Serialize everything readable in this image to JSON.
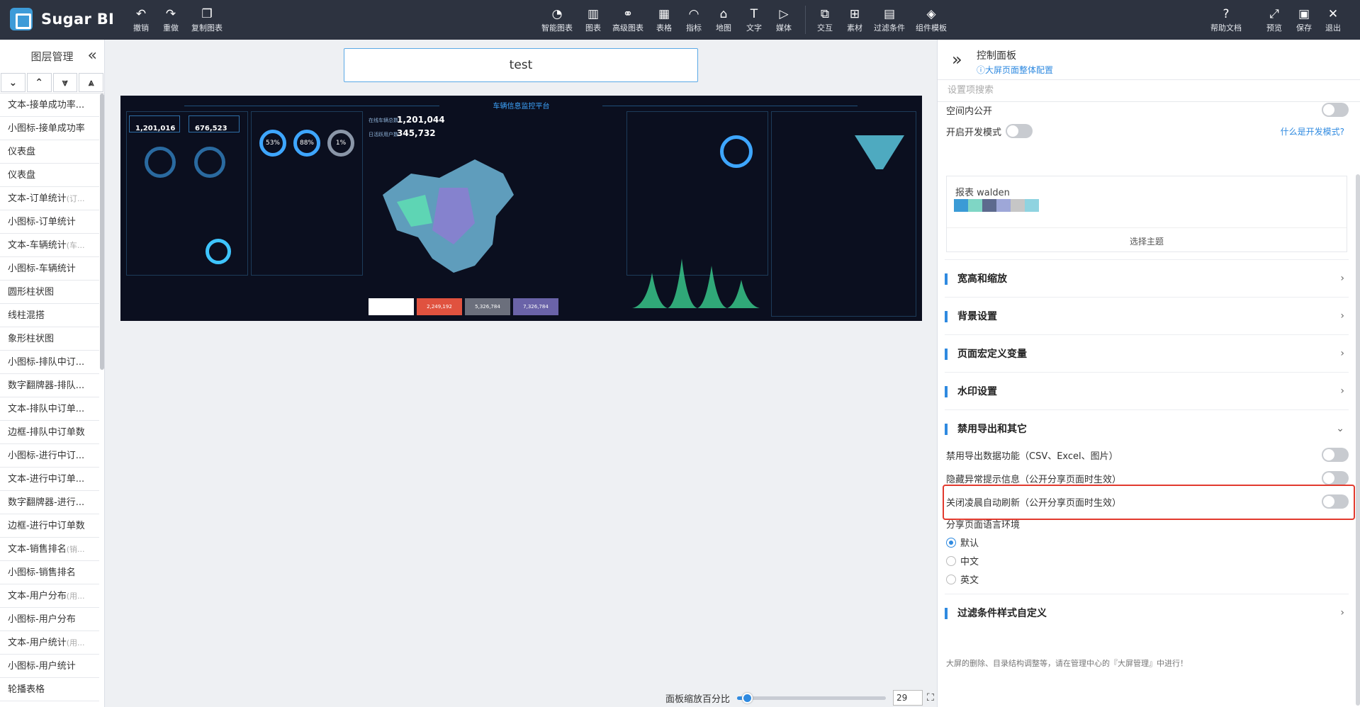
{
  "app": {
    "name": "Sugar BI"
  },
  "toolbar": {
    "undo": "撤销",
    "redo": "重做",
    "copy": "复制图表",
    "smart_chart": "智能图表",
    "chart": "图表",
    "advanced_chart": "高级图表",
    "table": "表格",
    "metric": "指标",
    "map": "地图",
    "text": "文字",
    "media": "媒体",
    "interaction": "交互",
    "material": "素材",
    "filter": "过滤条件",
    "component_template": "组件模板",
    "help": "帮助文档",
    "preview": "预览",
    "save": "保存",
    "exit": "退出"
  },
  "layers": {
    "title": "图层管理",
    "items": [
      {
        "label": "文本-接单成功率...",
        "hint": ""
      },
      {
        "label": "小图标-接单成功率",
        "hint": ""
      },
      {
        "label": "仪表盘",
        "hint": ""
      },
      {
        "label": "仪表盘",
        "hint": ""
      },
      {
        "label": "文本-订单统计",
        "hint": "(订..."
      },
      {
        "label": "小图标-订单统计",
        "hint": ""
      },
      {
        "label": "文本-车辆统计",
        "hint": "(车..."
      },
      {
        "label": "小图标-车辆统计",
        "hint": ""
      },
      {
        "label": "圆形柱状图",
        "hint": ""
      },
      {
        "label": "线柱混搭",
        "hint": ""
      },
      {
        "label": "象形柱状图",
        "hint": ""
      },
      {
        "label": "小图标-排队中订...",
        "hint": ""
      },
      {
        "label": "数字翻牌器-排队...",
        "hint": ""
      },
      {
        "label": "文本-排队中订单...",
        "hint": ""
      },
      {
        "label": "边框-排队中订单数",
        "hint": ""
      },
      {
        "label": "小图标-进行中订...",
        "hint": ""
      },
      {
        "label": "文本-进行中订单...",
        "hint": ""
      },
      {
        "label": "数字翻牌器-进行...",
        "hint": ""
      },
      {
        "label": "边框-进行中订单数",
        "hint": ""
      },
      {
        "label": "文本-销售排名",
        "hint": "(销..."
      },
      {
        "label": "小图标-销售排名",
        "hint": ""
      },
      {
        "label": "文本-用户分布",
        "hint": "(用..."
      },
      {
        "label": "小图标-用户分布",
        "hint": ""
      },
      {
        "label": "文本-用户统计",
        "hint": "(用..."
      },
      {
        "label": "小图标-用户统计",
        "hint": ""
      },
      {
        "label": "轮播表格",
        "hint": ""
      }
    ]
  },
  "canvas": {
    "title_value": "test",
    "zoom_label": "面板缩放百分比",
    "zoom_value": "29",
    "zoom_fraction": 0.05
  },
  "preview": {
    "title": "车辆信息监控平台",
    "kpi1": "1,201,016",
    "kpi2": "676,523",
    "kpi3_label": "在线车辆总数",
    "kpi3": "1,201,044",
    "kpi4_label": "日活跃用户数",
    "kpi4": "345,732",
    "ring1": "53%",
    "ring2": "88%",
    "ring3": "1%",
    "btn2": "2,249,192",
    "btn3": "5,326,784",
    "btn4": "7,326,784"
  },
  "panel": {
    "title": "控制面板",
    "link": "大屏页面整体配置",
    "search_placeholder": "设置项搜索",
    "public_in_space": "空间内公开",
    "dev_mode": "开启开发模式",
    "dev_mode_link": "什么是开发模式?",
    "theme_name": "报表  walden",
    "theme_colors": [
      "#3b9bd6",
      "#7fd6c5",
      "#5d6a8e",
      "#9ea7d8",
      "#c6c6c6",
      "#8fd3e0"
    ],
    "choose_theme": "选择主题",
    "sections": {
      "size": "宽高和缩放",
      "background": "背景设置",
      "macro": "页面宏定义变量",
      "watermark": "水印设置",
      "export": "禁用导出和其它",
      "filter_style": "过滤条件样式自定义"
    },
    "disable_export": "禁用导出数据功能（CSV、Excel、图片）",
    "hide_error": "隐藏异常提示信息（公开分享页面时生效）",
    "disable_refresh": "关闭凌晨自动刷新（公开分享页面时生效）",
    "lang_label": "分享页面语言环境",
    "lang_default": "默认",
    "lang_zh": "中文",
    "lang_en": "英文",
    "footnote": "大屏的删除、目录结构调整等，请在管理中心的『大屏管理』中进行！"
  }
}
